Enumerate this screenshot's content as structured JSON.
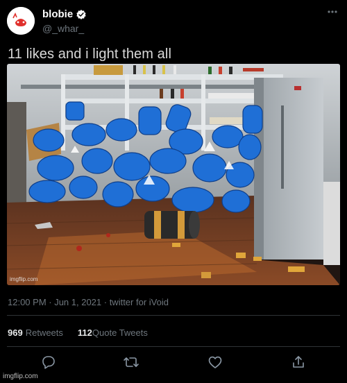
{
  "author": {
    "display_name": "blobie",
    "handle": "@_whar_",
    "verified": true
  },
  "tweet": {
    "text": "11 likes and i light them all",
    "media_watermark": "imgflip.com",
    "timestamp": "12:00 PM · Jun 1, 2021 · twitter for iVoid"
  },
  "stats": {
    "retweets_count": "969",
    "retweets_label": "Retweets",
    "quote_count": "112",
    "quote_label": "Quote Tweets"
  },
  "actions": [
    "reply-icon",
    "retweet-icon",
    "like-icon",
    "share-icon"
  ],
  "footer_watermark": "imgflip.com",
  "colors": {
    "background": "#000000",
    "muted_text": "#6e767d",
    "divider": "#2f3336",
    "tank_blue": "#1f6fd6"
  }
}
